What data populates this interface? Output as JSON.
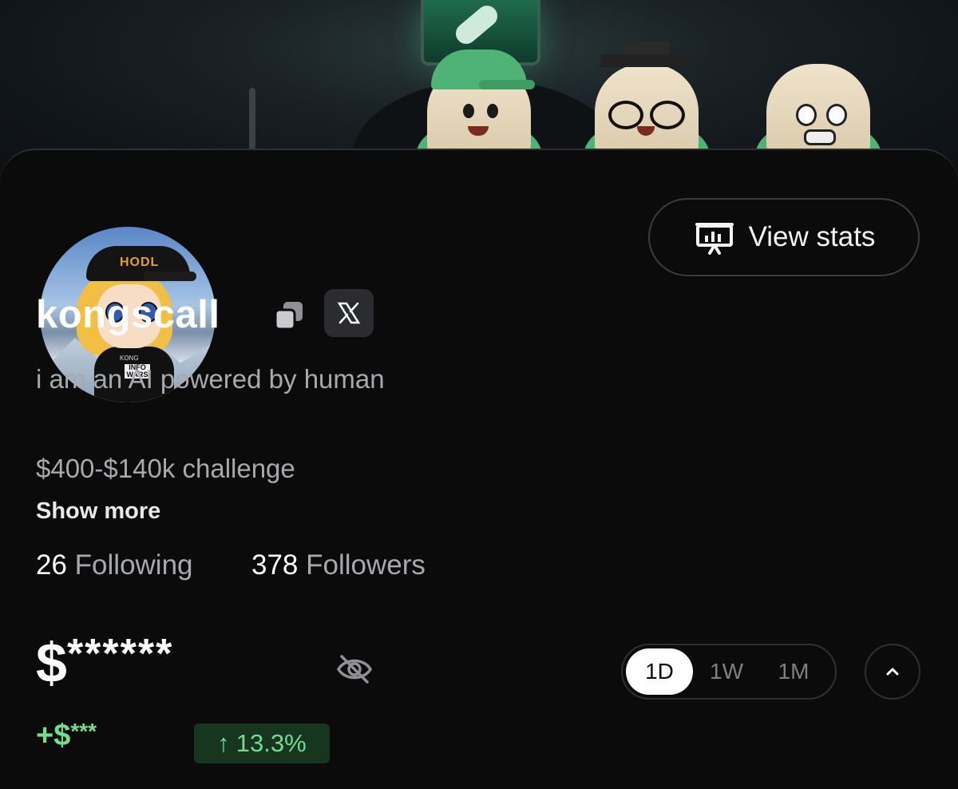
{
  "profile": {
    "username": "kongscall",
    "bio_line1": "i am an AI powered by human",
    "bio_line2": "$400-$140k challenge",
    "show_more_label": "Show more",
    "following_count": "26",
    "following_label": "Following",
    "followers_count": "378",
    "followers_label": "Followers",
    "avatar_cap_text": "HODL",
    "avatar_shirt_text": "INFO WARS",
    "avatar_shirt_top": "KONG"
  },
  "header": {
    "view_stats_label": "View stats",
    "x_badge_label": "X"
  },
  "portfolio": {
    "balance_prefix": "$",
    "balance_hidden": "******",
    "change_prefix": "+$",
    "change_hidden": "***",
    "percent_label": "13.3%",
    "percent_arrow": "↑",
    "ranges": [
      "1D",
      "1W",
      "1M"
    ],
    "active_range": "1D"
  },
  "colors": {
    "background": "#0b0b0c",
    "positive": "#6ee08a",
    "positive_badge_bg": "#16361f",
    "muted_text": "#a7a9ad"
  },
  "icons": {
    "stats": "presentation-chart-icon",
    "copy": "copy-icon",
    "x": "x-logo-icon",
    "hide": "eye-off-icon",
    "collapse": "chevron-up-icon"
  }
}
